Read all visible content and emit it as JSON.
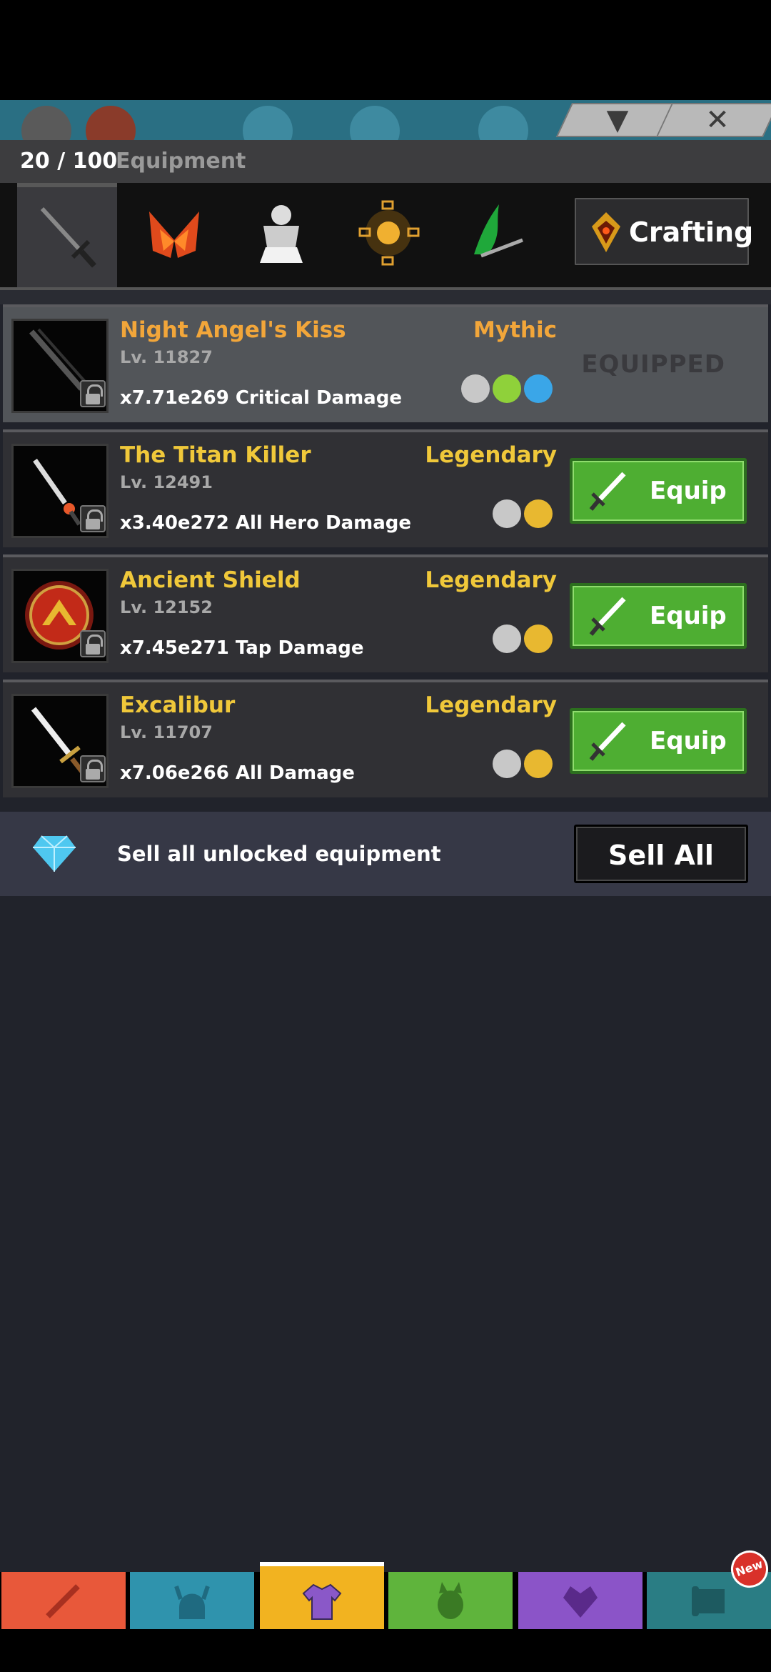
{
  "header": {
    "count": "20 / 100",
    "title": "Equipment"
  },
  "categories": [
    {
      "name": "sword",
      "selected": true
    },
    {
      "name": "helmet",
      "selected": false
    },
    {
      "name": "armor",
      "selected": false
    },
    {
      "name": "aura",
      "selected": false
    },
    {
      "name": "slash",
      "selected": false
    }
  ],
  "crafting": {
    "label": "Crafting",
    "icon": "crafting-gem-icon"
  },
  "items": [
    {
      "name": "Night Angel's Kiss",
      "level": "Lv. 11827",
      "bonus": "x7.71e269 Critical Damage",
      "rarity": "Mythic",
      "rarity_color": "#f2a63a",
      "name_color": "#f2a63a",
      "equipped": true,
      "status": "EQUIPPED",
      "set_icons": [
        "warrior-icon",
        "leaf-icon",
        "ice-icon"
      ]
    },
    {
      "name": "The Titan Killer",
      "level": "Lv. 12491",
      "bonus": "x3.40e272 All Hero Damage",
      "rarity": "Legendary",
      "rarity_color": "#f0c83a",
      "name_color": "#f0c83a",
      "equipped": false,
      "button": "Equip",
      "set_icons": [
        "warrior-icon",
        "claw-icon"
      ]
    },
    {
      "name": "Ancient Shield",
      "level": "Lv. 12152",
      "bonus": "x7.45e271 Tap Damage",
      "rarity": "Legendary",
      "rarity_color": "#f0c83a",
      "name_color": "#f0c83a",
      "equipped": false,
      "button": "Equip",
      "set_icons": [
        "warrior-icon",
        "claw-icon"
      ]
    },
    {
      "name": "Excalibur",
      "level": "Lv. 11707",
      "bonus": "x7.06e266 All Damage",
      "rarity": "Legendary",
      "rarity_color": "#f0c83a",
      "name_color": "#f0c83a",
      "equipped": false,
      "button": "Equip",
      "set_icons": [
        "warrior-icon",
        "claw-icon"
      ]
    }
  ],
  "sell": {
    "text": "Sell all unlocked equipment",
    "button": "Sell All"
  },
  "bottom_nav": [
    {
      "name": "sword",
      "color": "#e8583a"
    },
    {
      "name": "heroes",
      "color": "#2f93ad"
    },
    {
      "name": "equipment",
      "color": "#f2b320",
      "selected": true
    },
    {
      "name": "pets",
      "color": "#5fb43c"
    },
    {
      "name": "artifacts",
      "color": "#8b54c8"
    },
    {
      "name": "shop",
      "color": "#2a7d84"
    }
  ],
  "new_badge": "New"
}
